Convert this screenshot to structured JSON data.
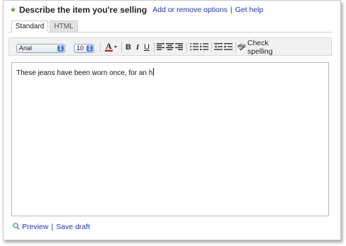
{
  "header": {
    "title": "Describe the item you're selling",
    "add_remove_options": "Add or remove options",
    "separator": "|",
    "get_help": "Get help"
  },
  "tabs": [
    {
      "label": "Standard",
      "selected": true
    },
    {
      "label": "HTML",
      "selected": false
    }
  ],
  "toolbar": {
    "font_family": "Arial",
    "font_size": "10",
    "bold_label": "B",
    "italic_label": "I",
    "underline_label": "U",
    "check_spelling": "Check spelling",
    "icons": [
      "font-color-icon",
      "bold-icon",
      "italic-icon",
      "underline-icon",
      "align-left-icon",
      "align-center-icon",
      "align-right-icon",
      "bullet-list-icon",
      "numbered-list-icon",
      "outdent-icon",
      "indent-icon",
      "spellcheck-icon"
    ]
  },
  "editor": {
    "text": "These jeans have been worn once, for an h"
  },
  "footer": {
    "preview": "Preview",
    "separator": "|",
    "save_draft": "Save draft"
  },
  "colors": {
    "link": "#1a35c0",
    "star": "#4a9a2a",
    "font_color_swatch": "#d02020",
    "select_arrow": "#4f7fd6"
  }
}
